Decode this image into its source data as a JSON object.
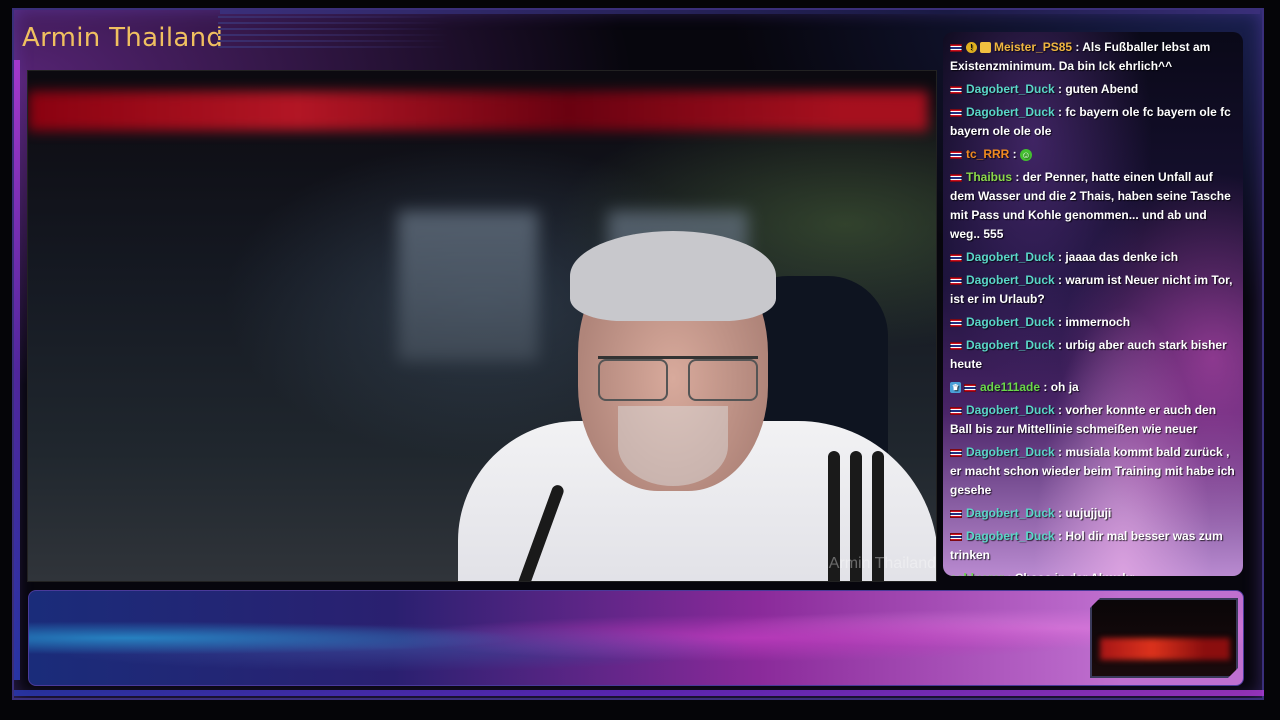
{
  "stream": {
    "title": "Armin Thailand",
    "webcam_watermark": "Armin Thailand"
  },
  "chat": {
    "messages": [
      {
        "badges": [
          "flag",
          "vip",
          "sub"
        ],
        "user": "Meister_PS85",
        "color": "#f0b640",
        "text": ": Als Fußballer lebst am Existenzminimum. Da bin Ick ehrlich^^"
      },
      {
        "badges": [
          "flag"
        ],
        "user": "Dagobert_Duck",
        "color": "#5ad7c8",
        "text": ": guten Abend"
      },
      {
        "badges": [
          "flag"
        ],
        "user": "Dagobert_Duck",
        "color": "#5ad7c8",
        "text": ": fc bayern ole fc bayern ole fc bayern ole ole ole"
      },
      {
        "badges": [
          "flag"
        ],
        "user": "tc_RRR",
        "color": "#f08a20",
        "text": ":",
        "emote": "green-emote"
      },
      {
        "badges": [
          "flag"
        ],
        "user": "Thaibus",
        "color": "#8ad84a",
        "text": ": der Penner, hatte einen Unfall auf dem Wasser und die 2 Thais, haben seine Tasche mit Pass und Kohle genommen... und ab und weg.. 555"
      },
      {
        "badges": [
          "flag"
        ],
        "user": "Dagobert_Duck",
        "color": "#5ad7c8",
        "text": ": jaaaa das denke ich"
      },
      {
        "badges": [
          "flag"
        ],
        "user": "Dagobert_Duck",
        "color": "#5ad7c8",
        "text": ": warum ist Neuer nicht im Tor, ist er im Urlaub?"
      },
      {
        "badges": [
          "flag"
        ],
        "user": "Dagobert_Duck",
        "color": "#5ad7c8",
        "text": ": immernoch"
      },
      {
        "badges": [
          "flag"
        ],
        "user": "Dagobert_Duck",
        "color": "#5ad7c8",
        "text": ": urbig aber auch stark bisher heute"
      },
      {
        "badges": [
          "prime",
          "flag"
        ],
        "user": "ade111ade",
        "color": "#6ad84a",
        "text": ": oh ja"
      },
      {
        "badges": [
          "flag"
        ],
        "user": "Dagobert_Duck",
        "color": "#5ad7c8",
        "text": ": vorher konnte er auch den Ball bis zur Mittellinie schmeißen wie neuer"
      },
      {
        "badges": [
          "flag"
        ],
        "user": "Dagobert_Duck",
        "color": "#5ad7c8",
        "text": ": musiala kommt bald zurück , er macht schon wieder beim Training mit habe ich gesehe"
      },
      {
        "badges": [
          "flag"
        ],
        "user": "Dagobert_Duck",
        "color": "#5ad7c8",
        "text": ": uujujjuji"
      },
      {
        "badges": [
          "flag"
        ],
        "user": "Dagobert_Duck",
        "color": "#5ad7c8",
        "text": ": Hol dir mal besser was zum trinken"
      },
      {
        "badges": [],
        "user": "schluerer",
        "color": "#6ad84a",
        "text": ": Chaos in der Abwehr..."
      }
    ]
  },
  "colors": {
    "title": "#f0c060",
    "frame": "#3a2f7a",
    "accent_purple": "#b03ad8"
  }
}
